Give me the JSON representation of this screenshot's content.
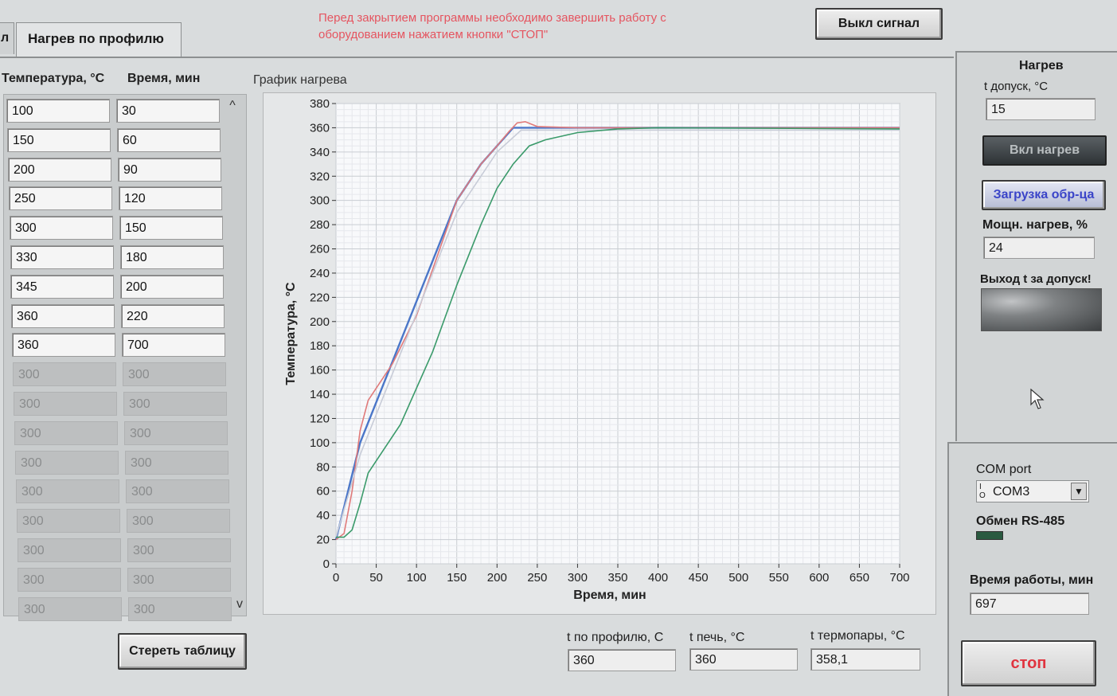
{
  "tabs": {
    "prev_tab": "л",
    "active_tab": "Нагрев по профилю"
  },
  "warning_text": "Перед закрытием программы необходимо завершить работу с оборудованием нажатием кнопки \"СТОП\"",
  "signal_button": "Выкл сигнал",
  "table": {
    "col_temp": "Температура, °С",
    "col_time": "Время, мин",
    "rows": [
      {
        "t": "100",
        "m": "30"
      },
      {
        "t": "150",
        "m": "60"
      },
      {
        "t": "200",
        "m": "90"
      },
      {
        "t": "250",
        "m": "120"
      },
      {
        "t": "300",
        "m": "150"
      },
      {
        "t": "330",
        "m": "180"
      },
      {
        "t": "345",
        "m": "200"
      },
      {
        "t": "360",
        "m": "220"
      },
      {
        "t": "360",
        "m": "700"
      },
      {
        "t": "300",
        "m": "300"
      },
      {
        "t": "300",
        "m": "300"
      },
      {
        "t": "300",
        "m": "300"
      },
      {
        "t": "300",
        "m": "300"
      },
      {
        "t": "300",
        "m": "300"
      },
      {
        "t": "300",
        "m": "300"
      },
      {
        "t": "300",
        "m": "300"
      },
      {
        "t": "300",
        "m": "300"
      },
      {
        "t": "300",
        "m": "300"
      }
    ],
    "active_rows": 9,
    "scroll_up": "^",
    "scroll_down": "v",
    "clear_button": "Стереть таблицу"
  },
  "chart_title": "График нагрева",
  "readouts": {
    "profile_label": "t по профилю, С",
    "profile_value": "360",
    "oven_label": "t печь, °С",
    "oven_value": "360",
    "thermo_label": "t термопары, °С",
    "thermo_value": "358,1"
  },
  "right_panel": {
    "heat_title": "Нагрев",
    "tolerance_label": "t допуск, °С",
    "tolerance_value": "15",
    "heat_on_button": "Вкл нагрев",
    "load_button": "Загрузка обр-ца",
    "power_label": "Мощн. нагрев, %",
    "power_value": "24",
    "alarm_label": "Выход t за допуск!",
    "com_label": "COM port",
    "com_value": "COM3",
    "rs485_label": "Обмен RS-485",
    "runtime_label": "Время работы, мин",
    "runtime_value": "697",
    "stop_button": "стоп"
  },
  "chart_data": {
    "type": "line",
    "xlabel": "Время, мин",
    "ylabel": "Температура, °С",
    "xlim": [
      0,
      700
    ],
    "ylim": [
      0,
      380
    ],
    "xticks": [
      0,
      50,
      100,
      150,
      200,
      250,
      300,
      350,
      400,
      450,
      500,
      550,
      600,
      650,
      700
    ],
    "yticks": [
      0,
      20,
      40,
      60,
      80,
      100,
      120,
      140,
      160,
      180,
      200,
      220,
      240,
      260,
      280,
      300,
      320,
      340,
      360,
      380
    ],
    "grid": true,
    "series": [
      {
        "color": "#4a76c8",
        "x": [
          0,
          30,
          60,
          90,
          120,
          150,
          180,
          200,
          220,
          700
        ],
        "y": [
          20,
          100,
          150,
          200,
          250,
          300,
          330,
          345,
          360,
          360
        ]
      },
      {
        "color": "#e07a7a",
        "x": [
          0,
          10,
          20,
          30,
          40,
          50,
          70,
          100,
          150,
          180,
          200,
          215,
          225,
          235,
          250,
          300,
          700
        ],
        "y": [
          20,
          25,
          60,
          110,
          135,
          145,
          165,
          205,
          300,
          330,
          345,
          357,
          364,
          365,
          361,
          360,
          360
        ]
      },
      {
        "color": "#c8ccd8",
        "x": [
          0,
          30,
          60,
          90,
          120,
          150,
          180,
          200,
          230,
          700
        ],
        "y": [
          22,
          90,
          140,
          190,
          240,
          290,
          320,
          340,
          358,
          358
        ]
      },
      {
        "color": "#3a9a6a",
        "x": [
          0,
          10,
          20,
          30,
          40,
          50,
          80,
          120,
          150,
          180,
          200,
          220,
          240,
          260,
          300,
          350,
          400,
          700
        ],
        "y": [
          22,
          22,
          28,
          50,
          75,
          85,
          115,
          175,
          230,
          280,
          310,
          330,
          345,
          350,
          356,
          359,
          360,
          359
        ]
      }
    ]
  }
}
